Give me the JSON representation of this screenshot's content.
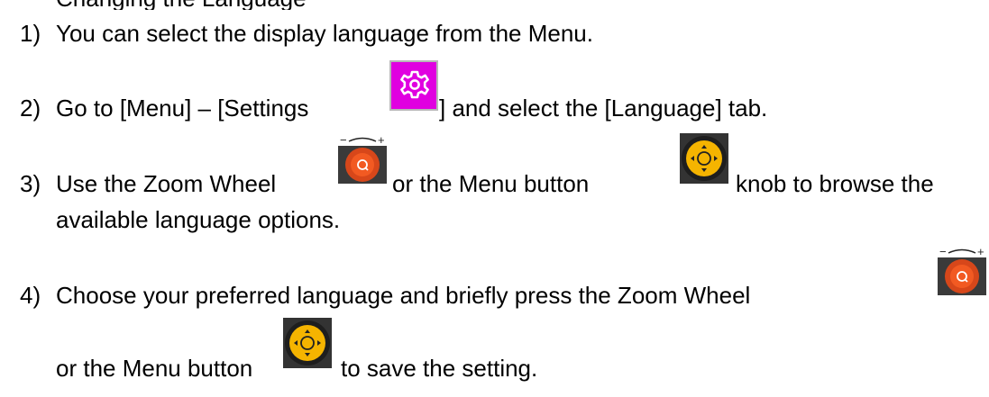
{
  "heading_partial": "Changing the Language",
  "steps": [
    {
      "number": "1)",
      "text": "You can select the display language from the Menu."
    },
    {
      "number": "2)",
      "text_before": "Go to [Menu] – [Settings",
      "icon": "settings-gear-icon",
      "text_after": "] and select the [Language] tab."
    },
    {
      "number": "3)",
      "text_part1": "Use the Zoom Wheel",
      "icon1": "zoom-wheel-icon",
      "text_part2": "or the Menu button",
      "icon2": "menu-button-knob-icon",
      "text_part3": "knob to browse the",
      "text_line2": "available language options."
    },
    {
      "number": "4)",
      "text_part1": "Choose your preferred language and briefly press the Zoom Wheel",
      "icon1": "zoom-wheel-icon",
      "text_line2_part1": "or the Menu button",
      "icon2": "menu-button-knob-icon",
      "text_line2_part2": "to save the setting."
    }
  ],
  "colors": {
    "settings_icon_bg": "#e000e0",
    "zoom_wheel_orange": "#f25a22",
    "menu_knob_yellow": "#f5b400",
    "icon_dark_bg": "#2a2a2a"
  }
}
